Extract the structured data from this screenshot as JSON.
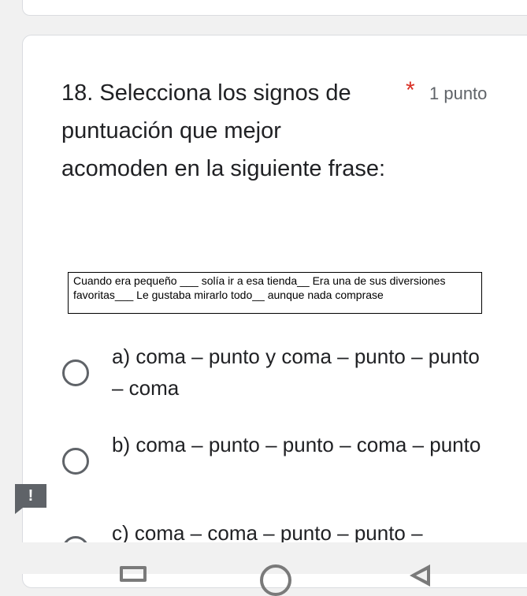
{
  "question": {
    "title": "18. Selecciona los signos de puntuación que mejor acomoden en la siguiente frase:",
    "required_mark": "*",
    "points": "1 punto",
    "sentence": "Cuando era pequeño ___ solía ir a esa tienda__ Era una de sus diversiones favoritas___ Le gustaba mirarlo todo__ aunque nada comprase"
  },
  "options": [
    {
      "label": "a) coma – punto y coma – punto – punto – coma"
    },
    {
      "label": "b) coma – punto – punto – coma – punto"
    },
    {
      "label": "c) coma – coma – punto – punto –"
    }
  ],
  "alert": {
    "symbol": "!"
  },
  "colors": {
    "required": "#d93025",
    "radio_border": "#5f6368",
    "card_border": "#dadce0",
    "background": "#f1f1f1"
  },
  "icons": {
    "nav": [
      "recents-icon",
      "home-icon",
      "back-icon"
    ]
  }
}
